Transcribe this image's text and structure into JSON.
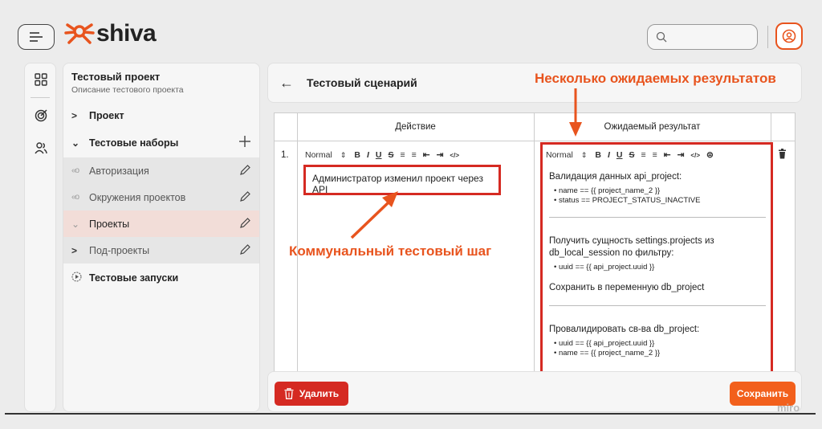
{
  "app": {
    "logo_text": "shiva"
  },
  "colors": {
    "accent": "#e8541e",
    "danger": "#d52a22",
    "save": "#f2601c"
  },
  "search": {
    "placeholder": ""
  },
  "project": {
    "title": "Тестовый проект",
    "description": "Описание тестового проекта"
  },
  "nav": {
    "project": "Проект",
    "test_suites": "Тестовые наборы",
    "suites": [
      {
        "label": "Авторизация"
      },
      {
        "label": "Окружения проектов"
      },
      {
        "label": "Проекты"
      },
      {
        "label": "Под-проекты"
      }
    ],
    "test_runs": "Тестовые запуски"
  },
  "scenario": {
    "title": "Тестовый сценарий",
    "col_action": "Действие",
    "col_expected": "Ожидаемый результат",
    "row_number": "1.",
    "toolbar_format": "Normal",
    "action_text": "Администратор изменил проект через API",
    "expected": {
      "block1_title": "Валидация данных api_project:",
      "block1_items": [
        "name == {{ project_name_2 }}",
        "status == PROJECT_STATUS_INACTIVE"
      ],
      "block2_title": "Получить сущность settings.projects из db_local_session по фильтру:",
      "block2_items": [
        "uuid == {{ api_project.uuid }}"
      ],
      "block2_footer": "Сохранить в переменную db_project",
      "block3_title": "Провалидировать св-ва db_project:",
      "block3_items": [
        "uuid == {{ api_project.uuid }}",
        "name == {{ project_name_2 }}"
      ]
    }
  },
  "buttons": {
    "delete": "Удалить",
    "save": "Сохранить"
  },
  "annotations": {
    "multiple_results": "Несколько ожидаемых результатов",
    "communal_step": "Коммунальный тестовый шаг"
  },
  "watermark": "miro"
}
